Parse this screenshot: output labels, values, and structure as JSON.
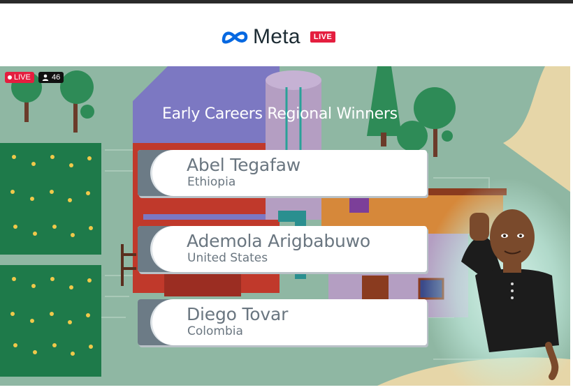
{
  "header": {
    "brand_name": "Meta",
    "live_label": "LIVE"
  },
  "stream": {
    "live_badge": "LIVE",
    "viewer_count": "46",
    "title": "Early Careers Regional Winners",
    "winners": [
      {
        "name": "Abel Tegafaw",
        "country": "Ethiopia"
      },
      {
        "name": "Ademola Arigbabuwo",
        "country": "United States"
      },
      {
        "name": "Diego Tovar",
        "country": "Colombia"
      }
    ]
  },
  "colors": {
    "accent_red": "#e41e3f",
    "meta_blue": "#0668e1",
    "scene_green": "#8fb7a3"
  }
}
